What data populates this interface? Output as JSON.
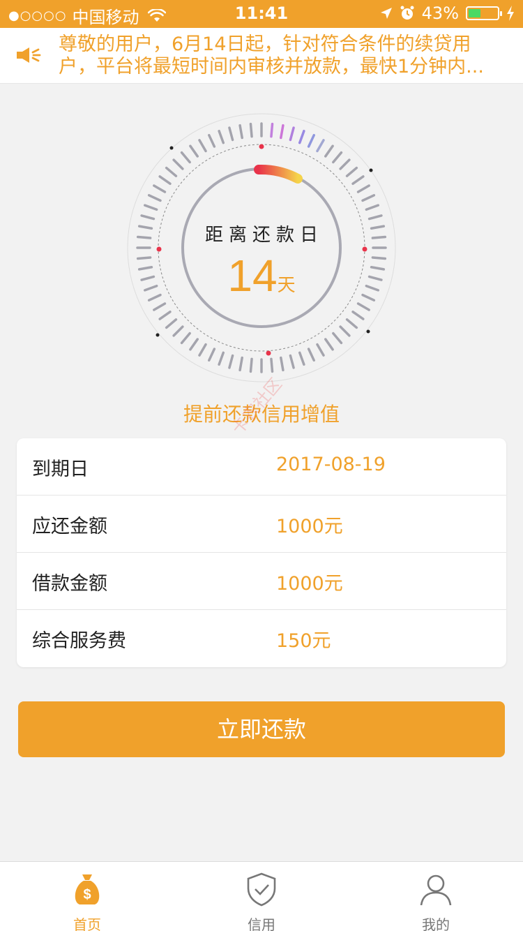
{
  "status_bar": {
    "signal_dots": "●○○○○",
    "carrier": "中国移动",
    "time": "11:41",
    "battery_percent": "43%",
    "battery_level": 0.43
  },
  "notice": {
    "icon": "speaker-icon",
    "text": "尊敬的用户，6月14日起，针对符合条件的续贷用户，平台将最短时间内审核并放款，最快1分钟内..."
  },
  "countdown": {
    "label": "距离还款日",
    "days": "14",
    "unit": "天"
  },
  "tagline": "提前还款信用增值",
  "details": [
    {
      "label": "到期日",
      "value": "2017-08-19"
    },
    {
      "label": "应还金额",
      "value": "1000元"
    },
    {
      "label": "借款金额",
      "value": "1000元"
    },
    {
      "label": "综合服务费",
      "value": "150元"
    }
  ],
  "pay_button": "立即还款",
  "watermark": "卡农社区",
  "tabs": [
    {
      "label": "首页",
      "icon": "money-bag-icon",
      "active": true
    },
    {
      "label": "信用",
      "icon": "shield-check-icon",
      "active": false
    },
    {
      "label": "我的",
      "icon": "person-icon",
      "active": false
    }
  ],
  "colors": {
    "accent": "#f0a12b",
    "background": "#f2f2f2"
  }
}
